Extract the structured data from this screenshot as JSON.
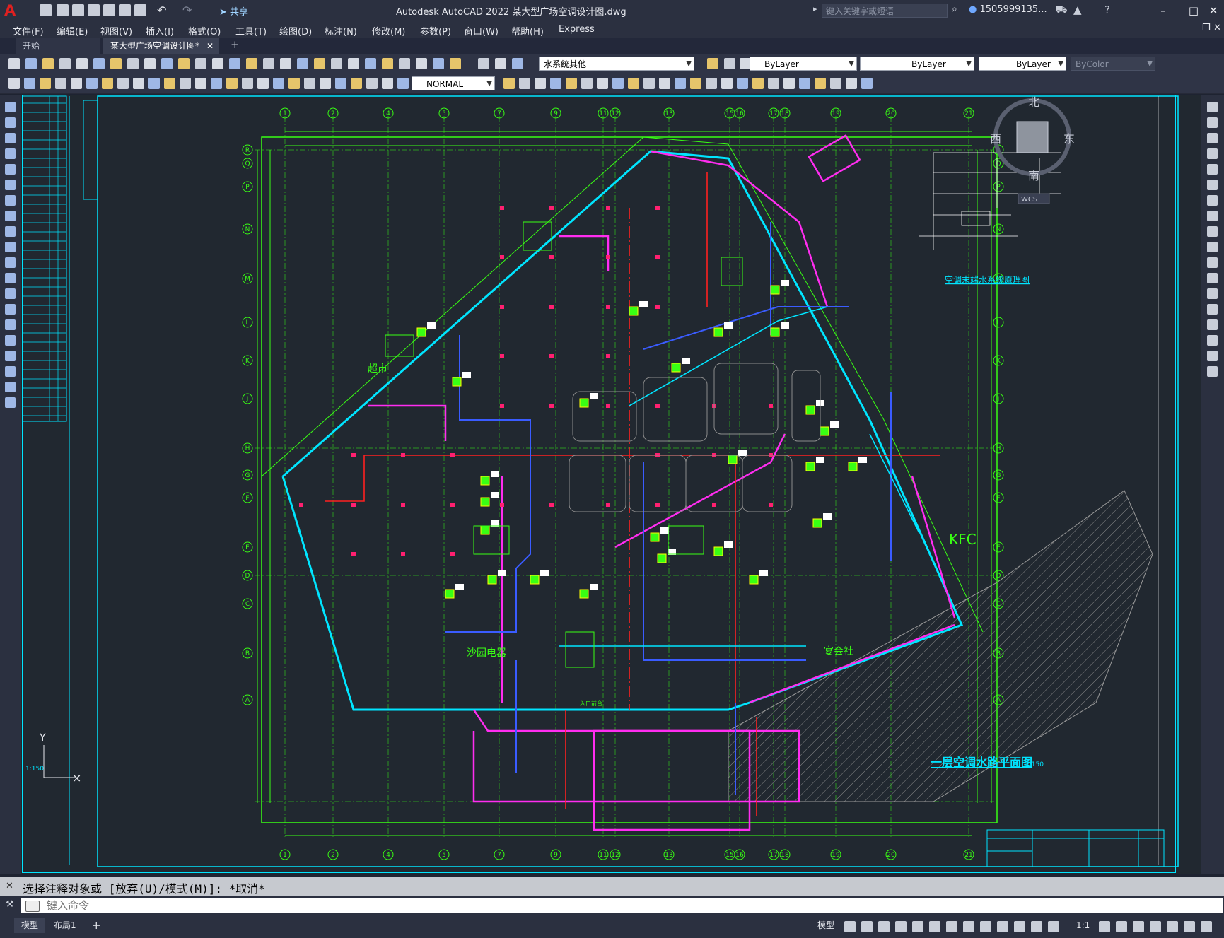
{
  "app": {
    "title": "Autodesk AutoCAD 2022    某大型广场空调设计图.dwg",
    "share_label": "共享",
    "search_placeholder": "键入关键字或短语",
    "user": "1505999135...",
    "logo_letter": "A"
  },
  "menu": [
    "文件(F)",
    "编辑(E)",
    "视图(V)",
    "插入(I)",
    "格式(O)",
    "工具(T)",
    "绘图(D)",
    "标注(N)",
    "修改(M)",
    "参数(P)",
    "窗口(W)",
    "帮助(H)",
    "Express"
  ],
  "tabs": {
    "start": "开始",
    "drawing": "某大型广场空调设计图*"
  },
  "toolbar": {
    "layer": "水系统其他",
    "color": "ByLayer",
    "linetype": "ByLayer",
    "lineweight": "ByLayer",
    "plotstyle": "ByColor",
    "textstyle": "NORMAL"
  },
  "drawing": {
    "plan_title": "一层空调水路平面图",
    "scale": "1:150",
    "scale_left": "1:150",
    "schematic_title": "空调末端水系统原理图",
    "labels": {
      "supermarket": "超市",
      "kfc": "KFC",
      "sales": "沙园电器",
      "snack": "宴会社",
      "entrance": "入口前台"
    },
    "compass": {
      "north": "北",
      "south": "南",
      "east": "东",
      "west": "西",
      "wcs": "WCS"
    },
    "ucs_y": "Y",
    "col_nums": [
      "1",
      "2",
      "4",
      "5",
      "7",
      "9",
      "11",
      "12",
      "13",
      "15",
      "16",
      "17",
      "18",
      "19",
      "20",
      "21"
    ],
    "row_letters": [
      "R",
      "Q",
      "P",
      "N",
      "M",
      "L",
      "K",
      "J",
      "H",
      "G",
      "F",
      "E",
      "D",
      "C",
      "B",
      "A"
    ]
  },
  "command": {
    "history": "选择注释对象或 [放弃(U)/模式(M)]: *取消*",
    "placeholder": "键入命令"
  },
  "status": {
    "model_tab": "模型",
    "layout_tab": "布局1",
    "model_btn": "模型",
    "scale": "1:1"
  },
  "colors": {
    "bg": "#212830",
    "cyan": "#00e5ff",
    "magenta": "#ff2df0",
    "green": "#39ff14",
    "red": "#ff2020",
    "blue": "#3a5cff"
  }
}
